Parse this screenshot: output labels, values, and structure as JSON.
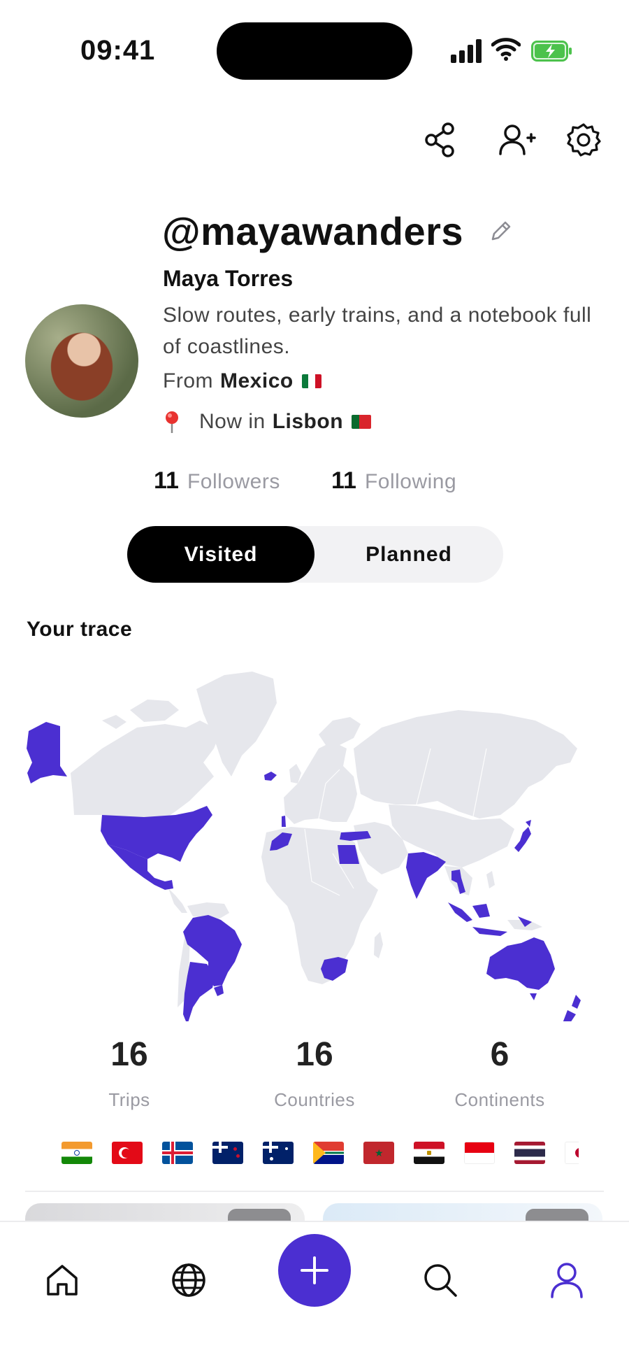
{
  "status_bar": {
    "time": "09:41"
  },
  "profile": {
    "username": "@mayawanders",
    "full_name": "Maya Torres",
    "bio": "Slow routes, early trains, and a notebook full of coastlines.",
    "from_prefix": "From",
    "from_country": "Mexico",
    "now_prefix": "Now in",
    "now_city": "Lisbon"
  },
  "counts": {
    "followers_count": "11",
    "followers_label": "Followers",
    "following_count": "11",
    "following_label": "Following"
  },
  "tabs": {
    "visited": "Visited",
    "planned": "Planned",
    "active": "visited"
  },
  "section": {
    "trace_title": "Your trace"
  },
  "map": {
    "highlight_color": "#4b2fd1",
    "base_color": "#e6e7ec",
    "visited_regions": [
      "Alaska",
      "United States",
      "Mexico",
      "Iceland",
      "Brazil",
      "Argentina",
      "Uruguay",
      "Portugal",
      "Morocco",
      "Turkey",
      "Egypt",
      "India",
      "Thailand",
      "Indonesia",
      "Japan",
      "South Africa",
      "Australia",
      "New Zealand"
    ]
  },
  "stats": {
    "trips_value": "16",
    "trips_label": "Trips",
    "countries_value": "16",
    "countries_label": "Countries",
    "continents_value": "6",
    "continents_label": "Continents"
  },
  "flags": [
    "India",
    "Turkey",
    "Iceland",
    "New Zealand",
    "Australia",
    "South Africa",
    "Morocco",
    "Egypt",
    "Indonesia",
    "Thailand",
    "Japan"
  ],
  "colors": {
    "accent": "#4b2fd1",
    "muted_text": "#9a9aa2",
    "segment_bg": "#f2f2f4"
  },
  "icons": {
    "share": "share-icon",
    "add_user": "add-user-icon",
    "settings": "gear-icon",
    "edit": "pencil-icon",
    "home": "home-icon",
    "globe": "globe-icon",
    "add": "plus-icon",
    "search": "search-icon",
    "profile": "user-icon"
  }
}
